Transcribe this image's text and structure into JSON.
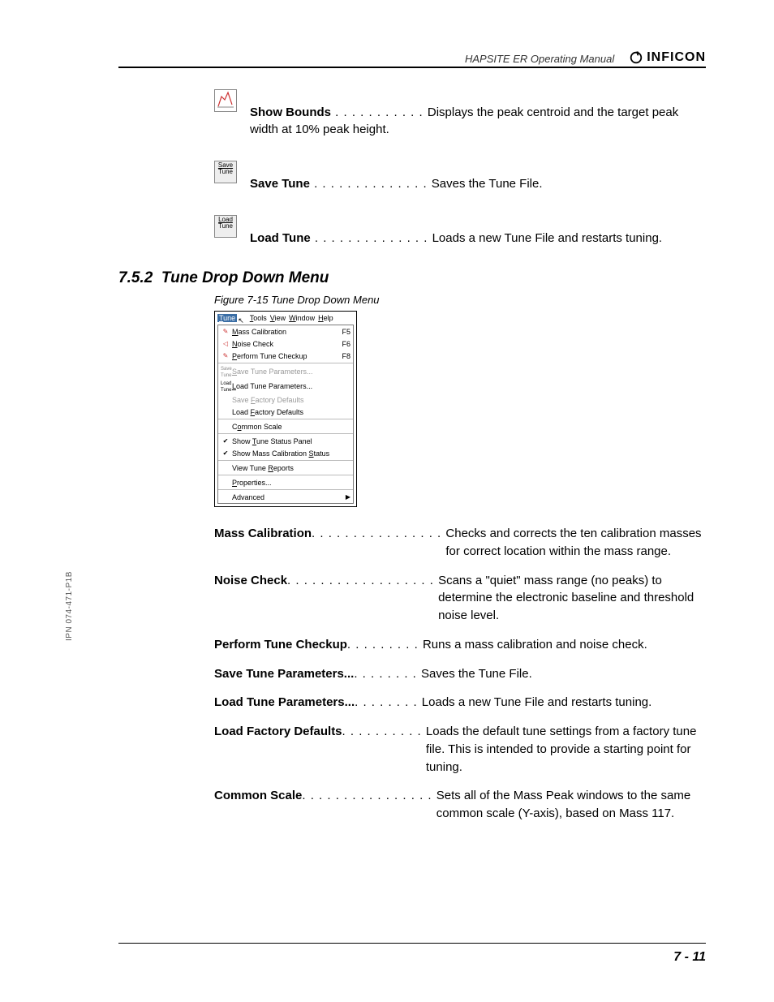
{
  "header": {
    "doc_title": "HAPSITE ER Operating Manual",
    "logo_text": "INFICON"
  },
  "side_note": "IPN 074-471-P1B",
  "icon_entries": [
    {
      "icon": "bounds",
      "term": "Show Bounds",
      "dots": " . . . . . . . . . . . ",
      "desc": "Displays the peak centroid and the target peak width at 10% peak height."
    },
    {
      "icon": "save",
      "term": "Save Tune",
      "dots": " . . . . . . . . . . . . . . ",
      "desc": "Saves the Tune File."
    },
    {
      "icon": "load",
      "term": "Load Tune",
      "dots": " . . . . . . . . . . . . . . ",
      "desc": "Loads a new Tune File and restarts tuning."
    }
  ],
  "section": {
    "num": "7.5.2",
    "title": "Tune Drop Down Menu"
  },
  "figure_caption": "Figure 7-15  Tune Drop Down Menu",
  "menu_bar": [
    "Tune",
    "Tools",
    "View",
    "Window",
    "Help"
  ],
  "menu_items": [
    {
      "icon": "mass",
      "label": "Mass Calibration",
      "u": 0,
      "key": "F5"
    },
    {
      "icon": "noise",
      "label": "Noise Check",
      "u": 0,
      "key": "F6"
    },
    {
      "icon": "tune",
      "label": "Perform Tune Checkup",
      "u": 0,
      "key": "F8"
    },
    {
      "sep": true
    },
    {
      "icon": "save",
      "label": "Save Tune Parameters...",
      "u": 0,
      "disabled": true
    },
    {
      "icon": "load",
      "label": "Load Tune Parameters...",
      "u": 0
    },
    {
      "label": "Save Factory Defaults",
      "u": 5,
      "disabled": true
    },
    {
      "label": "Load Factory Defaults",
      "u": 5
    },
    {
      "sep": true
    },
    {
      "label": "Common Scale",
      "u": 1
    },
    {
      "sep": true
    },
    {
      "check": true,
      "label": "Show Tune Status Panel",
      "u": 5
    },
    {
      "check": true,
      "label": "Show Mass Calibration Status",
      "u": 22
    },
    {
      "sep": true
    },
    {
      "label": "View Tune Reports",
      "u": 10
    },
    {
      "sep": true
    },
    {
      "label": "Properties...",
      "u": 0
    },
    {
      "sep": true
    },
    {
      "label": "Advanced",
      "arrow": true
    }
  ],
  "definitions": [
    {
      "term": "Mass Calibration",
      "dots": ". . . . . . . . . . . . . . . .",
      "desc": "Checks and corrects the ten calibration masses for correct location within the mass range."
    },
    {
      "term": "Noise Check",
      "dots": " . . . . . . . . . . . . . . . . . .",
      "desc": "Scans a \"quiet\" mass range (no peaks) to determine the electronic baseline and threshold noise level."
    },
    {
      "term": "Perform Tune Checkup",
      "dots": "  . . . . . . . . .",
      "desc": "Runs a mass calibration and noise check."
    },
    {
      "term": "Save Tune Parameters...",
      "dots": "  . . . . . . . .",
      "desc": "Saves the Tune File."
    },
    {
      "term": "Load Tune Parameters...",
      "dots": "  . . . . . . . .",
      "desc": "Loads a new Tune File and restarts tuning."
    },
    {
      "term": "Load Factory Defaults",
      "dots": " . . . . . . . . . .",
      "desc": "Loads the default tune settings from a factory tune file. This is intended to provide a starting point for tuning."
    },
    {
      "term": "Common Scale",
      "dots": " . . . . . . . . . . . . . . . .",
      "desc": "Sets all of the Mass Peak windows to the same common scale (Y-axis), based on Mass 117."
    }
  ],
  "page_num": "7 - 11"
}
